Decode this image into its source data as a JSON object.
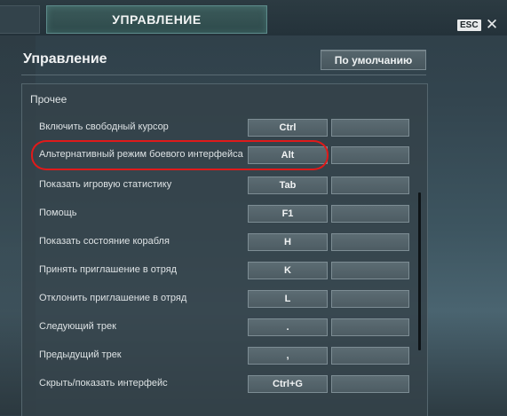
{
  "top_tab": {
    "active_label": "УПРАВЛЕНИЕ"
  },
  "window": {
    "esc_label": "ESC",
    "close_glyph": "✕"
  },
  "header": {
    "title": "Управление",
    "default_button": "По умолчанию"
  },
  "section": {
    "title": "Прочее",
    "rows": [
      {
        "label": "Включить свободный курсор",
        "key1": "Ctrl",
        "key2": ""
      },
      {
        "label": "Альтернативный режим боевого интерфейса",
        "key1": "Alt",
        "key2": ""
      },
      {
        "label": "Показать игровую статистику",
        "key1": "Tab",
        "key2": ""
      },
      {
        "label": "Помощь",
        "key1": "F1",
        "key2": ""
      },
      {
        "label": "Показать состояние корабля",
        "key1": "H",
        "key2": ""
      },
      {
        "label": "Принять приглашение в отряд",
        "key1": "K",
        "key2": ""
      },
      {
        "label": "Отклонить приглашение в отряд",
        "key1": "L",
        "key2": ""
      },
      {
        "label": "Следующий трек",
        "key1": ".",
        "key2": ""
      },
      {
        "label": "Предыдущий трек",
        "key1": ",",
        "key2": ""
      },
      {
        "label": "Скрыть/показать интерфейс",
        "key1": "Ctrl+G",
        "key2": ""
      }
    ]
  },
  "highlight": {
    "row_index": 1,
    "color": "#e01a1a"
  }
}
